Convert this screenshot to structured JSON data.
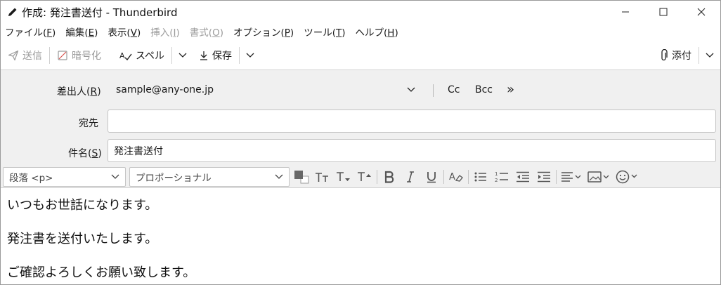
{
  "window": {
    "title": "作成: 発注書送付 - Thunderbird"
  },
  "menubar": {
    "items": [
      {
        "label": "ファイル",
        "key": "F"
      },
      {
        "label": "編集",
        "key": "E"
      },
      {
        "label": "表示",
        "key": "V"
      },
      {
        "label": "挿入",
        "key": "I",
        "disabled": true
      },
      {
        "label": "書式",
        "key": "O",
        "disabled": true
      },
      {
        "label": "オプション",
        "key": "P"
      },
      {
        "label": "ツール",
        "key": "T"
      },
      {
        "label": "ヘルプ",
        "key": "H"
      }
    ]
  },
  "toolbar": {
    "send_label": "送信",
    "encrypt_label": "暗号化",
    "spell_label": "スペル",
    "save_label": "保存",
    "attach_label": "添付"
  },
  "headers": {
    "from_label": "差出人",
    "from_key": "R",
    "from_value": "sample@any-one.jp",
    "cc_label": "Cc",
    "bcc_label": "Bcc",
    "more_label": "»",
    "to_label": "宛先",
    "to_value": "",
    "subject_label": "件名",
    "subject_key": "S",
    "subject_value": "発注書送付"
  },
  "format": {
    "paragraph_value": "段落 <p>",
    "font_value": "プロポーショナル"
  },
  "body": {
    "lines": [
      "いつもお世話になります。",
      "発注書を送付いたします。",
      "ご確認よろしくお願い致します。"
    ]
  },
  "colors": {
    "header_bg": "#f0f0f0",
    "disabled_text": "#9b9b9b",
    "icon": "#555555"
  }
}
